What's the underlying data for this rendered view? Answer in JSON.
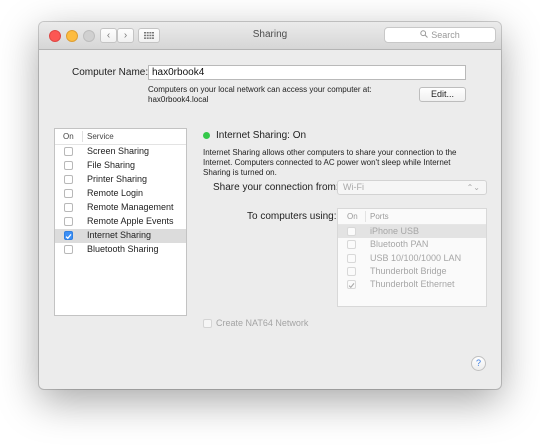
{
  "window": {
    "title": "Sharing"
  },
  "toolbar": {
    "back_icon": "chevron-left-icon",
    "forward_icon": "chevron-right-icon",
    "grid_icon": "grid-icon",
    "search_placeholder": "Search"
  },
  "computer": {
    "label": "Computer Name:",
    "name": "hax0rbook4",
    "description_line1": "Computers on your local network can access your computer at:",
    "description_line2": "hax0rbook4.local",
    "edit_button": "Edit..."
  },
  "services": {
    "header_on": "On",
    "header_service": "Service",
    "items": [
      {
        "label": "Screen Sharing",
        "checked": false
      },
      {
        "label": "File Sharing",
        "checked": false
      },
      {
        "label": "Printer Sharing",
        "checked": false
      },
      {
        "label": "Remote Login",
        "checked": false
      },
      {
        "label": "Remote Management",
        "checked": false
      },
      {
        "label": "Remote Apple Events",
        "checked": false
      },
      {
        "label": "Internet Sharing",
        "checked": true,
        "selected": true
      },
      {
        "label": "Bluetooth Sharing",
        "checked": false
      }
    ]
  },
  "detail": {
    "status": "Internet Sharing: On",
    "status_color": "#34c84a",
    "info_line1": "Internet Sharing allows other computers to share your connection to the",
    "info_line2": "Internet. Computers connected to AC power won't sleep while Internet",
    "info_line3": "Sharing is turned on.",
    "share_from_label": "Share your connection from:",
    "share_from_value": "Wi-Fi",
    "to_computers_label": "To computers using:",
    "ports_header_on": "On",
    "ports_header_ports": "Ports",
    "ports": [
      {
        "label": "iPhone USB",
        "checked": false,
        "selected": true
      },
      {
        "label": "Bluetooth PAN",
        "checked": false
      },
      {
        "label": "USB 10/100/1000 LAN",
        "checked": false
      },
      {
        "label": "Thunderbolt Bridge",
        "checked": false
      },
      {
        "label": "Thunderbolt Ethernet",
        "checked": true
      }
    ],
    "nat64_label": "Create NAT64 Network"
  },
  "help_button": "?"
}
